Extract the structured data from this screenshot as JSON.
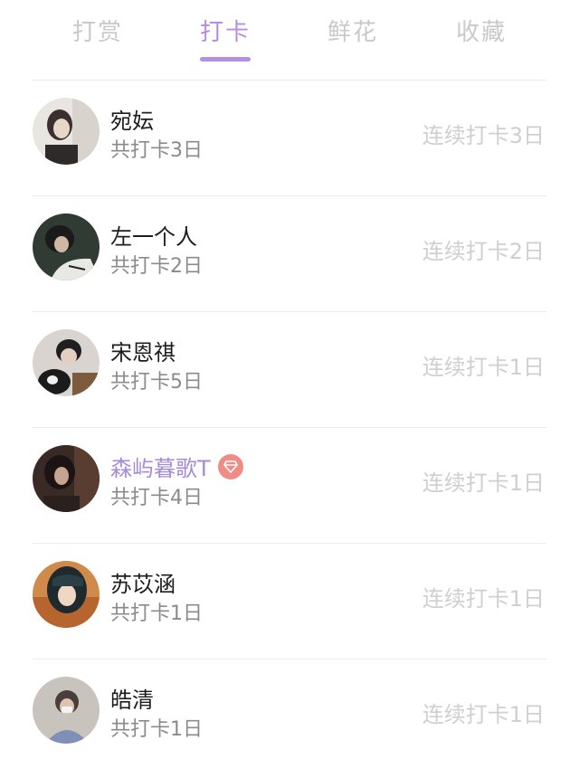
{
  "tabs": [
    {
      "label": "打赏",
      "active": false
    },
    {
      "label": "打卡",
      "active": true
    },
    {
      "label": "鲜花",
      "active": false
    },
    {
      "label": "收藏",
      "active": false
    }
  ],
  "colors": {
    "accent": "#b48ee0",
    "vip_name": "#a58cd6",
    "vip_badge": "#f08c86",
    "tab_inactive": "#c9c9c9",
    "streak_text": "#cfcfcf",
    "total_text": "#8b8b8b"
  },
  "users": [
    {
      "name": "宛妘",
      "total": "共打卡3日",
      "streak": "连续打卡3日",
      "vip": false
    },
    {
      "name": "左一个人",
      "total": "共打卡2日",
      "streak": "连续打卡2日",
      "vip": false
    },
    {
      "name": "宋恩祺",
      "total": "共打卡5日",
      "streak": "连续打卡1日",
      "vip": false
    },
    {
      "name": "森屿暮歌T",
      "total": "共打卡4日",
      "streak": "连续打卡1日",
      "vip": true,
      "badge_icon": "diamond-icon"
    },
    {
      "name": "苏苡涵",
      "total": "共打卡1日",
      "streak": "连续打卡1日",
      "vip": false
    },
    {
      "name": "皓清",
      "total": "共打卡1日",
      "streak": "连续打卡1日",
      "vip": false
    }
  ]
}
